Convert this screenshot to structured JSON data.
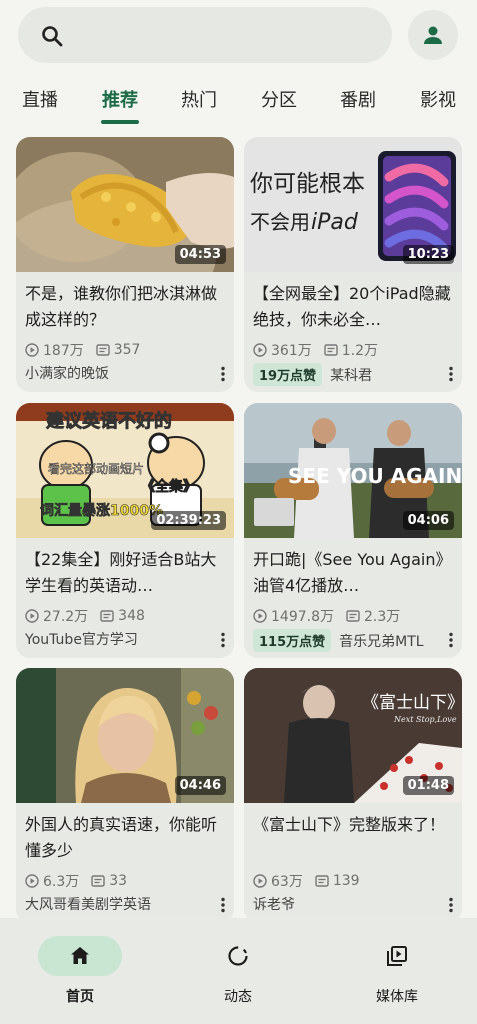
{
  "search": {
    "icon": "search-icon"
  },
  "header": {
    "account_icon": "account-icon"
  },
  "tabs": [
    {
      "label": "直播"
    },
    {
      "label": "推荐"
    },
    {
      "label": "热门"
    },
    {
      "label": "分区"
    },
    {
      "label": "番剧"
    },
    {
      "label": "影视"
    }
  ],
  "active_tab": "推荐",
  "cards": [
    {
      "duration": "04:53",
      "title": "不是，谁教你们把冰淇淋做成这样的？",
      "views": "187万",
      "comments": "357",
      "likes_badge": "",
      "author": "小满家的晚饭"
    },
    {
      "thumb_text_1": "你可能根本",
      "thumb_text_2": "不会用",
      "thumb_text_3": "iPad",
      "duration": "10:23",
      "title": "【全网最全】20个iPad隐藏绝技，你未必全…",
      "views": "361万",
      "comments": "1.2万",
      "likes_badge": "19万点赞",
      "author": "某科君"
    },
    {
      "thumb_text_1": "建议英语不好的",
      "thumb_text_2": "看完这部动画短片",
      "thumb_text_3": "《全集》",
      "thumb_text_4": "词汇量暴涨1000%",
      "duration": "02:39:23",
      "title": "【22集全】刚好适合B站大学生看的英语动…",
      "views": "27.2万",
      "comments": "348",
      "likes_badge": "",
      "author": "YouTube官方学习"
    },
    {
      "thumb_text_1": "SEE YOU AGAIN",
      "duration": "04:06",
      "title": "开口跪|《See You Again》油管4亿播放…",
      "views": "1497.8万",
      "comments": "2.3万",
      "likes_badge": "115万点赞",
      "author": "音乐兄弟MTL"
    },
    {
      "duration": "04:46",
      "title": "外国人的真实语速，你能听懂多少",
      "views": "6.3万",
      "comments": "33",
      "likes_badge": "",
      "author": "大风哥看美剧学英语"
    },
    {
      "thumb_text_1": "《富士山下》",
      "thumb_text_2": "Next Stop,Love",
      "duration": "01:48",
      "title": "《富士山下》完整版来了！",
      "views": "63万",
      "comments": "139",
      "likes_badge": "",
      "author": "诉老爷"
    }
  ],
  "bottom_nav": [
    {
      "label": "首页",
      "icon": "home-icon"
    },
    {
      "label": "动态",
      "icon": "activity-icon"
    },
    {
      "label": "媒体库",
      "icon": "library-icon"
    }
  ],
  "colors": {
    "accent": "#1b6b46",
    "background": "#f4f5f1",
    "card": "#e7e9e4",
    "badge": "#cfe6d6"
  }
}
